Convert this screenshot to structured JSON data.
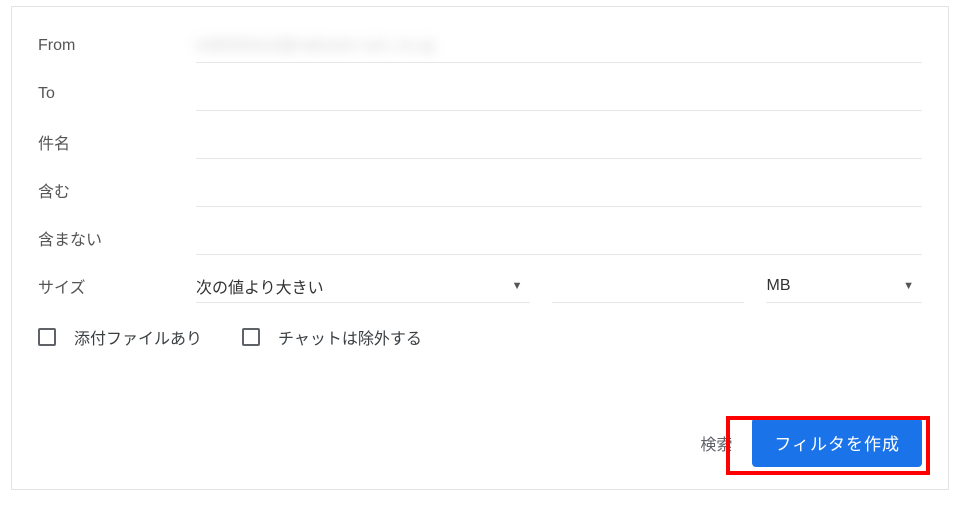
{
  "fields": {
    "from": {
      "label": "From",
      "value": "m8050test@rakuten-sec.co.jp"
    },
    "to": {
      "label": "To",
      "value": ""
    },
    "subject": {
      "label": "件名",
      "value": ""
    },
    "includes": {
      "label": "含む",
      "value": ""
    },
    "excludes": {
      "label": "含まない",
      "value": ""
    }
  },
  "size": {
    "label": "サイズ",
    "comparator": "次の値より大きい",
    "value": "",
    "unit": "MB"
  },
  "checkboxes": {
    "has_attachment": {
      "label": "添付ファイルあり",
      "checked": false
    },
    "exclude_chats": {
      "label": "チャットは除外する",
      "checked": false
    }
  },
  "actions": {
    "search": "検索",
    "create_filter": "フィルタを作成"
  }
}
